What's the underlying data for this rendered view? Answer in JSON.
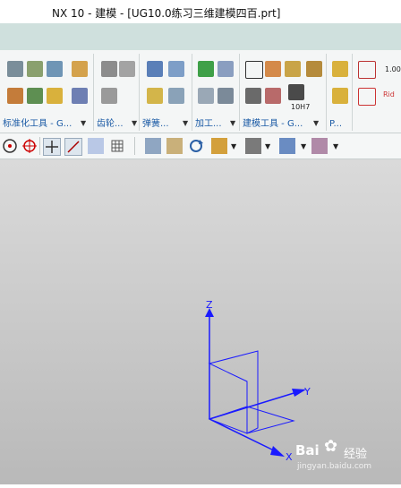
{
  "window": {
    "title": "NX 10 - 建模 - [UG10.0练习三维建模四百.prt]"
  },
  "ribbon_groups": [
    {
      "label": "标准化工具 - G..."
    },
    {
      "label": "齿轮..."
    },
    {
      "label": "弹簧..."
    },
    {
      "label": "加工..."
    },
    {
      "label": "建模工具 - G..."
    },
    {
      "label": "P..."
    }
  ],
  "ribbon_texts": {
    "num": "1.00",
    "tol": "10H7",
    "rid": "Rid"
  },
  "axes": {
    "x": "X",
    "y": "Y",
    "z": "Z"
  },
  "watermark": {
    "brand": "Bai",
    "suffix": "经验",
    "url": "jingyan.baidu.com"
  },
  "colors": {
    "axis": "#1a1aff",
    "accent": "#1a5aa5",
    "band": "#cfe0dd"
  }
}
